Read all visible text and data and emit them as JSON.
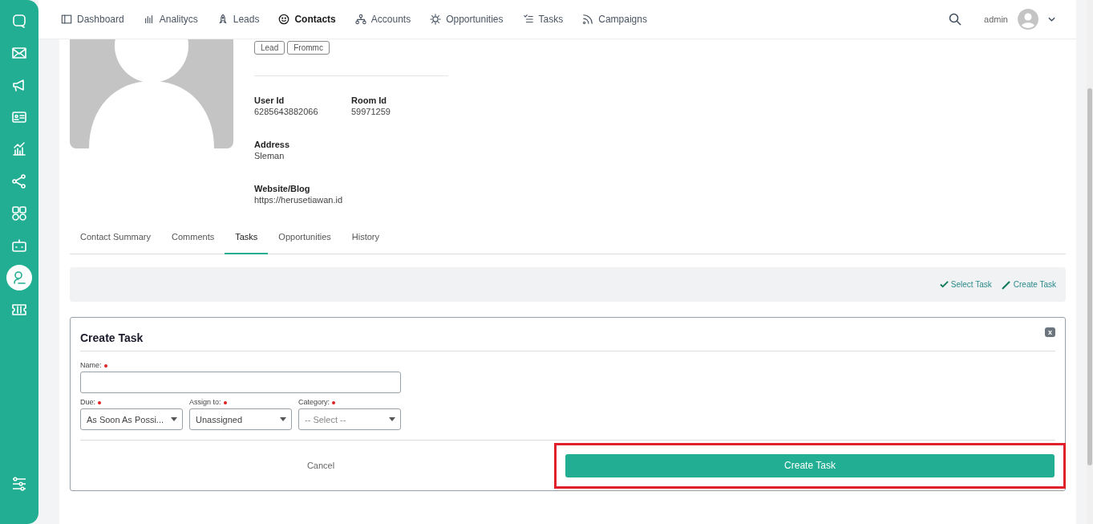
{
  "sidebar": {
    "items": [
      {
        "selected": false
      },
      {
        "selected": false
      },
      {
        "selected": false
      },
      {
        "selected": false
      },
      {
        "selected": false
      },
      {
        "selected": false
      },
      {
        "selected": false
      },
      {
        "selected": false
      },
      {
        "selected": true
      },
      {
        "selected": false
      }
    ]
  },
  "nav": {
    "items": [
      {
        "label": "Dashboard",
        "selected": false
      },
      {
        "label": "Analitycs",
        "selected": false
      },
      {
        "label": "Leads",
        "selected": false
      },
      {
        "label": "Contacts",
        "selected": true
      },
      {
        "label": "Accounts",
        "selected": false
      },
      {
        "label": "Opportunities",
        "selected": false
      },
      {
        "label": "Tasks",
        "selected": false
      },
      {
        "label": "Campaigns",
        "selected": false
      }
    ],
    "user": "admin"
  },
  "contact": {
    "tags": [
      "Lead",
      "Frommc"
    ],
    "fields": [
      {
        "label": "User Id",
        "value": "6285643882066"
      },
      {
        "label": "Room Id",
        "value": "59971259"
      },
      {
        "label": "Address",
        "value": "Sleman"
      },
      {
        "label": "Website/Blog",
        "value": "https://herusetiawan.id"
      }
    ]
  },
  "tabs": [
    {
      "label": "Contact Summary",
      "selected": false
    },
    {
      "label": "Comments",
      "selected": false
    },
    {
      "label": "Tasks",
      "selected": true
    },
    {
      "label": "Opportunities",
      "selected": false
    },
    {
      "label": "History",
      "selected": false
    }
  ],
  "actions": [
    "Select Task",
    "Create Task"
  ],
  "form": {
    "title": "Create Task",
    "close": "x",
    "name": {
      "label": "Name:"
    },
    "selects": [
      {
        "label": "Due:",
        "value": "As Soon As Possi..."
      },
      {
        "label": "Assign to:",
        "value": "Unassigned"
      },
      {
        "label": "Category:",
        "placeholder": "-- Select --"
      }
    ],
    "cancel": "Cancel",
    "submit": "Create Task"
  }
}
